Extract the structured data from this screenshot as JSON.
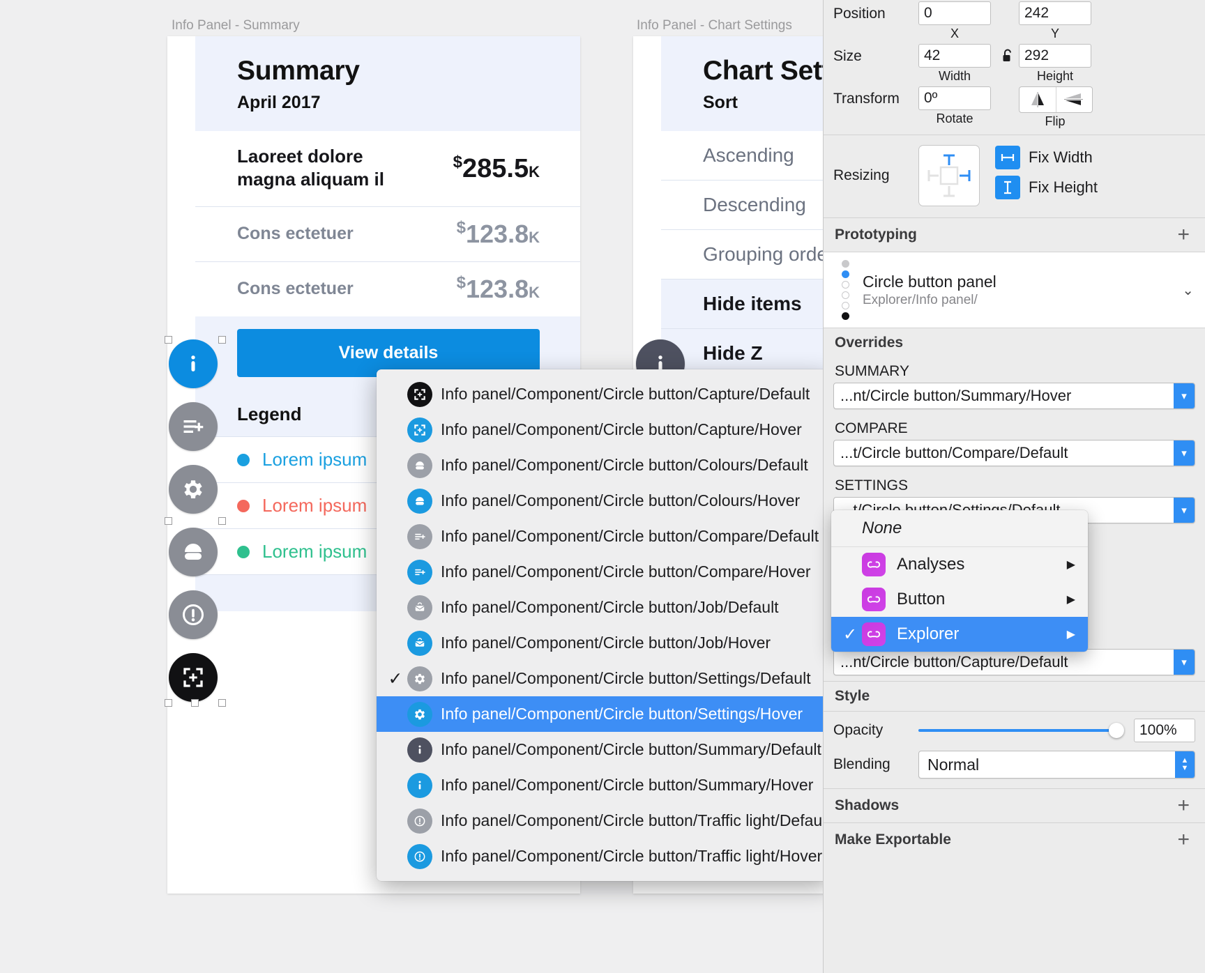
{
  "canvas": {
    "artboards": [
      {
        "label": "Info Panel - Summary"
      },
      {
        "label": "Info Panel - Chart Settings"
      }
    ],
    "summary_card": {
      "title": "Summary",
      "subtitle": "April 2017",
      "kpi_main": {
        "label_line1": "Laoreet dolore",
        "label_line2": "magna aliquam il",
        "currency": "$",
        "value": "285.5",
        "suffix": "K"
      },
      "kpi_rows": [
        {
          "label": "Cons ectetuer",
          "currency": "$",
          "value": "123.8",
          "suffix": "K"
        },
        {
          "label": "Cons ectetuer",
          "currency": "$",
          "value": "123.8",
          "suffix": "K"
        }
      ],
      "cta_label": "View details",
      "legend_title": "Legend",
      "legend_items": [
        {
          "label": "Lorem ipsum",
          "color": "#1aa0e0"
        },
        {
          "label": "Lorem ipsum",
          "color": "#f4685c"
        },
        {
          "label": "Lorem ipsum",
          "color": "#2fc08e"
        }
      ]
    },
    "chart_settings_card": {
      "title": "Chart Sett",
      "subtitle": "Sort",
      "items": [
        {
          "label": "Ascending"
        },
        {
          "label": "Descending"
        },
        {
          "label": "Grouping orde"
        },
        {
          "label": "Hide items"
        },
        {
          "label": "Hide Z"
        }
      ]
    },
    "circle_buttons": [
      {
        "name": "summary",
        "icon": "info-icon",
        "state": "hover"
      },
      {
        "name": "compare",
        "icon": "compare-icon",
        "state": "default"
      },
      {
        "name": "settings",
        "icon": "gear-icon",
        "state": "default"
      },
      {
        "name": "colours",
        "icon": "colours-icon",
        "state": "default"
      },
      {
        "name": "traffic-light",
        "icon": "exclamation-icon",
        "state": "default"
      },
      {
        "name": "capture",
        "icon": "capture-icon",
        "state": "selected"
      }
    ]
  },
  "context_menu": {
    "items": [
      {
        "label": "Info panel/Component/Circle button/Capture/Default",
        "icon": "capture-icon",
        "tone": "black",
        "checked": false,
        "selected": false
      },
      {
        "label": "Info panel/Component/Circle button/Capture/Hover",
        "icon": "capture-icon",
        "tone": "blue",
        "checked": false,
        "selected": false
      },
      {
        "label": "Info panel/Component/Circle button/Colours/Default",
        "icon": "colours-icon",
        "tone": "grey",
        "checked": false,
        "selected": false
      },
      {
        "label": "Info panel/Component/Circle button/Colours/Hover",
        "icon": "colours-icon",
        "tone": "blue",
        "checked": false,
        "selected": false
      },
      {
        "label": "Info panel/Component/Circle button/Compare/Default",
        "icon": "compare-icon",
        "tone": "grey",
        "checked": false,
        "selected": false
      },
      {
        "label": "Info panel/Component/Circle button/Compare/Hover",
        "icon": "compare-icon",
        "tone": "blue",
        "checked": false,
        "selected": false
      },
      {
        "label": "Info panel/Component/Circle button/Job/Default",
        "icon": "job-icon",
        "tone": "grey",
        "checked": false,
        "selected": false
      },
      {
        "label": "Info panel/Component/Circle button/Job/Hover",
        "icon": "job-icon",
        "tone": "blue",
        "checked": false,
        "selected": false
      },
      {
        "label": "Info panel/Component/Circle button/Settings/Default",
        "icon": "gear-icon",
        "tone": "grey",
        "checked": true,
        "selected": false
      },
      {
        "label": "Info panel/Component/Circle button/Settings/Hover",
        "icon": "gear-icon",
        "tone": "blue",
        "checked": false,
        "selected": true
      },
      {
        "label": "Info panel/Component/Circle button/Summary/Default",
        "icon": "info-icon",
        "tone": "darkgrey",
        "checked": false,
        "selected": false
      },
      {
        "label": "Info panel/Component/Circle button/Summary/Hover",
        "icon": "info-icon",
        "tone": "blue",
        "checked": false,
        "selected": false
      },
      {
        "label": "Info panel/Component/Circle button/Traffic light/Default",
        "icon": "exclamation-icon",
        "tone": "grey",
        "checked": false,
        "selected": false
      },
      {
        "label": "Info panel/Component/Circle button/Traffic light/Hover",
        "icon": "exclamation-icon",
        "tone": "blue",
        "checked": false,
        "selected": false
      }
    ]
  },
  "inspector": {
    "position": {
      "label": "Position",
      "x_value": "0",
      "x_caption": "X",
      "y_value": "242",
      "y_caption": "Y"
    },
    "size": {
      "label": "Size",
      "width_value": "42",
      "width_caption": "Width",
      "height_value": "292",
      "height_caption": "Height",
      "lock_icon": "unlocked-icon"
    },
    "transform": {
      "label": "Transform",
      "rotate_value": "0º",
      "rotate_caption": "Rotate",
      "flip_caption": "Flip"
    },
    "resizing": {
      "label": "Resizing",
      "fix_width_label": "Fix Width",
      "fix_height_label": "Fix Height"
    },
    "prototyping": {
      "title": "Prototyping",
      "add": "+",
      "target_name": "Circle button panel",
      "target_path": "Explorer/Info panel/"
    },
    "overrides": {
      "title": "Overrides",
      "fields": [
        {
          "label": "SUMMARY",
          "value": "...nt/Circle button/Summary/Hover"
        },
        {
          "label": "COMPARE",
          "value": "...t/Circle button/Compare/Default"
        },
        {
          "label": "SETTINGS",
          "value": "...t/Circle button/Settings/Default"
        },
        {
          "label": "",
          "value": "...nt/Circle button/Capture/Default"
        }
      ]
    },
    "symbol_popup": {
      "none_label": "None",
      "items": [
        {
          "label": "Analyses",
          "checked": false,
          "selected": false,
          "arrow": "▶"
        },
        {
          "label": "Button",
          "checked": false,
          "selected": false,
          "arrow": "▶"
        },
        {
          "label": "Explorer",
          "checked": true,
          "selected": true,
          "arrow": "▶"
        }
      ]
    },
    "style": {
      "title": "Style",
      "opacity_label": "Opacity",
      "opacity_value": "100%",
      "blending_label": "Blending",
      "blending_value": "Normal"
    },
    "shadows": {
      "title": "Shadows",
      "add": "+"
    },
    "make_exportable": {
      "title": "Make Exportable",
      "add": "+"
    }
  },
  "colors": {
    "accent_blue": "#0c8ce0",
    "selection_blue": "#3d8ef5",
    "grey_button": "#8a8d95",
    "symbol_purple": "#c93ae0"
  }
}
